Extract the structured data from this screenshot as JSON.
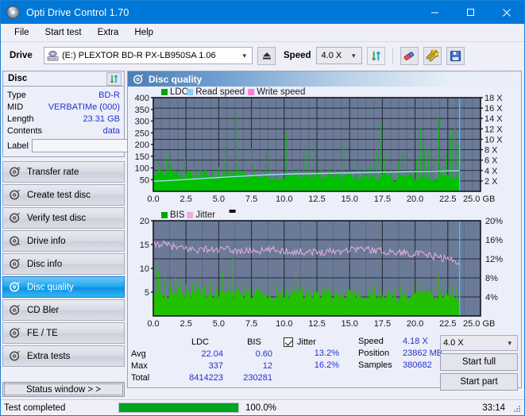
{
  "window": {
    "title": "Opti Drive Control 1.70",
    "icon": "disc-icon",
    "minimize": "minimize",
    "maximize": "maximize",
    "close": "close"
  },
  "menu": {
    "items": [
      "File",
      "Start test",
      "Extra",
      "Help"
    ]
  },
  "toolbar": {
    "drive_label": "Drive",
    "drive_value": "(E:)   PLEXTOR BD-R  PX-LB950SA 1.06",
    "eject_icon": "eject-icon",
    "speed_label": "Speed",
    "speed_value": "4.0 X",
    "refresh_icon": "refresh-icon",
    "erase_icon": "eraser-icon",
    "tools_icon": "wrench-icon",
    "save_icon": "save-icon"
  },
  "disc_panel": {
    "title": "Disc",
    "refresh_icon": "refresh-icon",
    "rows": [
      {
        "key": "Type",
        "value": "BD-R"
      },
      {
        "key": "MID",
        "value": "VERBATIMe (000)"
      },
      {
        "key": "Length",
        "value": "23.31 GB"
      },
      {
        "key": "Contents",
        "value": "data"
      }
    ],
    "label_key": "Label",
    "label_value": "",
    "label_placeholder": "",
    "disc_icon": "cd-icon"
  },
  "nav": {
    "items": [
      {
        "label": "Transfer rate",
        "icon": "disc-icon",
        "active": false
      },
      {
        "label": "Create test disc",
        "icon": "disc-icon",
        "active": false
      },
      {
        "label": "Verify test disc",
        "icon": "disc-icon",
        "active": false
      },
      {
        "label": "Drive info",
        "icon": "disc-icon",
        "active": false
      },
      {
        "label": "Disc info",
        "icon": "disc-icon",
        "active": false
      },
      {
        "label": "Disc quality",
        "icon": "disc-icon",
        "active": true
      },
      {
        "label": "CD Bler",
        "icon": "disc-icon",
        "active": false
      },
      {
        "label": "FE / TE",
        "icon": "disc-icon",
        "active": false
      },
      {
        "label": "Extra tests",
        "icon": "disc-icon",
        "active": false
      }
    ],
    "status_window": "Status window > >"
  },
  "panel": {
    "title": "Disc quality",
    "icon": "disc-icon"
  },
  "stats": {
    "col_headers": [
      "LDC",
      "BIS"
    ],
    "rows": [
      {
        "key": "Avg",
        "ldc": "22.04",
        "bis": "0.60"
      },
      {
        "key": "Max",
        "ldc": "337",
        "bis": "12"
      },
      {
        "key": "Total",
        "ldc": "8414223",
        "bis": "230281"
      }
    ],
    "jitter_label": "Jitter",
    "jitter_checked": true,
    "jitter_avg": "13.2%",
    "jitter_max": "16.2%",
    "speed_key": "Speed",
    "speed_value": "4.18 X",
    "position_key": "Position",
    "position_value": "23862 MB",
    "samples_key": "Samples",
    "samples_value": "380682",
    "speed_select": "4.0 X",
    "start_full": "Start full",
    "start_part": "Start part"
  },
  "statusbar": {
    "text": "Test completed",
    "progress_percent": 100,
    "percent_label": "100.0%",
    "time": "33:14"
  },
  "colors": {
    "accent": "#0078d7",
    "ldc_green": "#00c000",
    "read_speed": "#87cefa",
    "write_speed": "#ff7ae0",
    "bis_green": "#22c000",
    "jitter_pink": "#e6aee0",
    "plot_bg": "#6b7a96",
    "value_blue": "#2233cc",
    "progress_green": "#00a51e"
  },
  "chart_data": [
    {
      "type": "area",
      "title": "LDC / Read speed / Write speed",
      "xlabel": "GB",
      "ylabel": "LDC",
      "y2label": "X",
      "xlim": [
        0,
        25.0
      ],
      "ylim": [
        0,
        400
      ],
      "y2lim": [
        0,
        18
      ],
      "grid": true,
      "legend_position": "top-left",
      "legend": [
        {
          "name": "LDC",
          "color": "#00a800"
        },
        {
          "name": "Read speed",
          "color": "#87cefa"
        },
        {
          "name": "Write speed",
          "color": "#ff7ae0"
        }
      ],
      "xticks": [
        "0.0",
        "2.5",
        "5.0",
        "7.5",
        "10.0",
        "12.5",
        "15.0",
        "17.5",
        "20.0",
        "22.5",
        "25.0 GB"
      ],
      "yticks": [
        "50",
        "100",
        "150",
        "200",
        "250",
        "300",
        "350",
        "400"
      ],
      "y2ticks": [
        "2 X",
        "4 X",
        "6 X",
        "8 X",
        "10 X",
        "12 X",
        "14 X",
        "16 X",
        "18 X"
      ],
      "data_end_gb": 23.4,
      "series": [
        {
          "name": "LDC",
          "color": "#00c000",
          "baseline_x": [
            0.0,
            1.0,
            2.0,
            3.0,
            4.0,
            5.0,
            6.0,
            7.0,
            8.0,
            9.0,
            10.0,
            11.0,
            12.0,
            13.0,
            14.0,
            15.0,
            16.0,
            17.0,
            18.0,
            19.0,
            20.0,
            21.0,
            22.0,
            23.0,
            23.4
          ],
          "baseline_y": [
            70,
            72,
            68,
            66,
            65,
            64,
            66,
            67,
            64,
            63,
            62,
            61,
            63,
            60,
            59,
            61,
            58,
            60,
            57,
            58,
            59,
            57,
            56,
            58,
            57
          ],
          "spikes": [
            {
              "x": 0.45,
              "y": 130
            },
            {
              "x": 0.75,
              "y": 120
            },
            {
              "x": 1.05,
              "y": 148
            },
            {
              "x": 1.2,
              "y": 128
            },
            {
              "x": 1.35,
              "y": 158
            },
            {
              "x": 1.6,
              "y": 96
            },
            {
              "x": 2.1,
              "y": 92
            },
            {
              "x": 2.45,
              "y": 150
            },
            {
              "x": 2.6,
              "y": 96
            },
            {
              "x": 3.1,
              "y": 100
            },
            {
              "x": 3.6,
              "y": 94
            },
            {
              "x": 4.0,
              "y": 96
            },
            {
              "x": 4.6,
              "y": 88
            },
            {
              "x": 5.0,
              "y": 104
            },
            {
              "x": 5.5,
              "y": 190
            },
            {
              "x": 5.9,
              "y": 100
            },
            {
              "x": 6.3,
              "y": 331
            },
            {
              "x": 6.5,
              "y": 104
            },
            {
              "x": 7.0,
              "y": 94
            },
            {
              "x": 7.5,
              "y": 182
            },
            {
              "x": 7.7,
              "y": 100
            },
            {
              "x": 8.1,
              "y": 96
            },
            {
              "x": 8.6,
              "y": 175
            },
            {
              "x": 9.0,
              "y": 98
            },
            {
              "x": 9.5,
              "y": 94
            },
            {
              "x": 10.2,
              "y": 254
            },
            {
              "x": 10.6,
              "y": 96
            },
            {
              "x": 11.1,
              "y": 92
            },
            {
              "x": 11.5,
              "y": 168
            },
            {
              "x": 11.9,
              "y": 178
            },
            {
              "x": 12.4,
              "y": 212
            },
            {
              "x": 12.8,
              "y": 94
            },
            {
              "x": 13.4,
              "y": 96
            },
            {
              "x": 13.9,
              "y": 92
            },
            {
              "x": 14.4,
              "y": 188
            },
            {
              "x": 15.0,
              "y": 90
            },
            {
              "x": 15.6,
              "y": 120
            },
            {
              "x": 16.1,
              "y": 96
            },
            {
              "x": 16.6,
              "y": 112
            },
            {
              "x": 17.1,
              "y": 180
            },
            {
              "x": 17.4,
              "y": 291
            },
            {
              "x": 17.7,
              "y": 150
            },
            {
              "x": 18.2,
              "y": 96
            },
            {
              "x": 18.7,
              "y": 126
            },
            {
              "x": 19.1,
              "y": 175
            },
            {
              "x": 19.6,
              "y": 96
            },
            {
              "x": 20.1,
              "y": 142
            },
            {
              "x": 20.4,
              "y": 268
            },
            {
              "x": 20.7,
              "y": 180
            },
            {
              "x": 21.0,
              "y": 185
            },
            {
              "x": 21.4,
              "y": 120
            },
            {
              "x": 21.8,
              "y": 317
            },
            {
              "x": 22.1,
              "y": 110
            },
            {
              "x": 22.4,
              "y": 166
            },
            {
              "x": 22.7,
              "y": 245
            },
            {
              "x": 22.9,
              "y": 260
            },
            {
              "x": 23.1,
              "y": 280
            },
            {
              "x": 23.3,
              "y": 200
            }
          ]
        },
        {
          "name": "Read speed",
          "color": "#9fdcf8",
          "x": [
            0.0,
            1.0,
            2.0,
            3.0,
            4.0,
            5.0,
            6.0,
            7.0,
            8.0,
            9.0,
            10.0,
            11.0,
            12.0,
            13.0,
            14.0,
            16.0,
            18.0,
            20.0,
            22.0,
            23.4
          ],
          "y": [
            1.95,
            2.05,
            2.2,
            2.35,
            2.5,
            2.65,
            2.8,
            2.95,
            3.1,
            3.2,
            3.3,
            3.35,
            3.4,
            3.45,
            3.5,
            3.6,
            3.7,
            3.8,
            3.9,
            3.95
          ]
        }
      ],
      "cursor_gb": 23.4,
      "cursor_color": "#35c8ff"
    },
    {
      "type": "area",
      "title": "BIS / Jitter",
      "xlabel": "GB",
      "ylabel": "BIS",
      "y2label": "%",
      "xlim": [
        0,
        25.0
      ],
      "ylim": [
        0,
        20
      ],
      "y2lim": [
        0,
        20
      ],
      "grid": true,
      "legend_position": "top-left",
      "legend": [
        {
          "name": "BIS",
          "color": "#00a800"
        },
        {
          "name": "Jitter",
          "color": "#e6aee0"
        }
      ],
      "xticks": [
        "0.0",
        "2.5",
        "5.0",
        "7.5",
        "10.0",
        "12.5",
        "15.0",
        "17.5",
        "20.0",
        "22.5",
        "25.0 GB"
      ],
      "yticks": [
        "5",
        "10",
        "15",
        "20"
      ],
      "y2ticks": [
        "4%",
        "8%",
        "12%",
        "16%",
        "20%"
      ],
      "data_end_gb": 23.4,
      "series": [
        {
          "name": "BIS",
          "color": "#22c000",
          "baseline_x": [
            0.0,
            1.0,
            2.0,
            3.0,
            4.0,
            5.0,
            6.0,
            7.0,
            8.0,
            9.0,
            10.0,
            11.0,
            12.0,
            13.0,
            14.0,
            15.0,
            16.0,
            17.0,
            18.0,
            19.0,
            20.0,
            21.0,
            22.0,
            23.0,
            23.4
          ],
          "baseline_y": [
            5.1,
            5.0,
            4.9,
            4.8,
            4.8,
            4.7,
            4.7,
            4.6,
            4.6,
            4.5,
            4.5,
            4.4,
            4.3,
            4.3,
            4.2,
            4.2,
            4.1,
            4.1,
            4.1,
            4.0,
            4.0,
            4.0,
            3.9,
            4.0,
            3.9
          ],
          "spikes": [
            {
              "x": 0.2,
              "y": 11.0
            },
            {
              "x": 0.4,
              "y": 9.5
            },
            {
              "x": 0.6,
              "y": 7.2
            },
            {
              "x": 0.9,
              "y": 8.6
            },
            {
              "x": 1.3,
              "y": 7.0
            },
            {
              "x": 1.7,
              "y": 8.2
            },
            {
              "x": 2.1,
              "y": 7.5
            },
            {
              "x": 2.5,
              "y": 6.6
            },
            {
              "x": 3.0,
              "y": 7.0
            },
            {
              "x": 3.4,
              "y": 8.0
            },
            {
              "x": 3.9,
              "y": 6.4
            },
            {
              "x": 4.4,
              "y": 7.2
            },
            {
              "x": 4.9,
              "y": 6.6
            },
            {
              "x": 5.3,
              "y": 9.2
            },
            {
              "x": 5.7,
              "y": 7.8
            },
            {
              "x": 6.1,
              "y": 12.1
            },
            {
              "x": 6.5,
              "y": 6.4
            },
            {
              "x": 7.0,
              "y": 6.8
            },
            {
              "x": 7.4,
              "y": 6.0
            },
            {
              "x": 7.9,
              "y": 6.2
            },
            {
              "x": 8.4,
              "y": 6.5
            },
            {
              "x": 8.9,
              "y": 6.2
            },
            {
              "x": 9.4,
              "y": 6.8
            },
            {
              "x": 9.9,
              "y": 6.0
            },
            {
              "x": 10.4,
              "y": 6.4
            },
            {
              "x": 10.9,
              "y": 8.1
            },
            {
              "x": 11.4,
              "y": 6.2
            },
            {
              "x": 11.9,
              "y": 6.6
            },
            {
              "x": 12.4,
              "y": 6.0
            },
            {
              "x": 12.9,
              "y": 6.3
            },
            {
              "x": 13.4,
              "y": 6.0
            },
            {
              "x": 13.9,
              "y": 5.6
            },
            {
              "x": 14.4,
              "y": 6.1
            },
            {
              "x": 14.9,
              "y": 5.8
            },
            {
              "x": 15.4,
              "y": 6.2
            },
            {
              "x": 15.9,
              "y": 5.6
            },
            {
              "x": 16.4,
              "y": 6.0
            },
            {
              "x": 16.9,
              "y": 6.3
            },
            {
              "x": 17.4,
              "y": 5.8
            },
            {
              "x": 17.9,
              "y": 6.1
            },
            {
              "x": 18.4,
              "y": 5.9
            },
            {
              "x": 18.9,
              "y": 6.2
            },
            {
              "x": 19.4,
              "y": 5.7
            },
            {
              "x": 19.9,
              "y": 6.4
            },
            {
              "x": 20.4,
              "y": 6.8
            },
            {
              "x": 20.9,
              "y": 6.0
            },
            {
              "x": 21.4,
              "y": 6.2
            },
            {
              "x": 21.8,
              "y": 8.4
            },
            {
              "x": 22.2,
              "y": 6.1
            },
            {
              "x": 22.6,
              "y": 6.4
            },
            {
              "x": 22.9,
              "y": 6.6
            },
            {
              "x": 23.2,
              "y": 6.0
            }
          ]
        },
        {
          "name": "Jitter",
          "color": "#e6aee0",
          "x": [
            0.0,
            0.5,
            1.0,
            1.5,
            2.0,
            2.5,
            3.0,
            3.5,
            4.0,
            4.5,
            5.0,
            5.5,
            6.0,
            6.5,
            7.0,
            7.5,
            8.0,
            8.5,
            9.0,
            9.5,
            10.0,
            10.5,
            11.0,
            11.5,
            12.0,
            12.5,
            13.0,
            13.5,
            14.0,
            14.5,
            15.0,
            15.5,
            16.0,
            16.5,
            17.0,
            17.5,
            18.0,
            18.5,
            19.0,
            19.5,
            20.0,
            20.5,
            21.0,
            21.5,
            22.0,
            22.5,
            23.0,
            23.4
          ],
          "y": [
            14.8,
            15.2,
            14.9,
            14.6,
            14.2,
            14.1,
            14.0,
            13.9,
            14.1,
            13.8,
            13.9,
            14.0,
            13.8,
            13.7,
            13.6,
            13.8,
            13.7,
            13.6,
            13.9,
            13.8,
            13.7,
            13.6,
            13.4,
            13.5,
            13.6,
            13.3,
            13.5,
            13.7,
            13.6,
            13.8,
            14.0,
            14.2,
            14.1,
            13.9,
            13.8,
            13.6,
            13.5,
            13.3,
            13.4,
            13.2,
            13.1,
            12.9,
            12.7,
            12.5,
            12.2,
            11.9,
            11.6,
            11.5
          ]
        }
      ],
      "cursor_gb": 23.4,
      "cursor_color": "#35c8ff"
    }
  ]
}
